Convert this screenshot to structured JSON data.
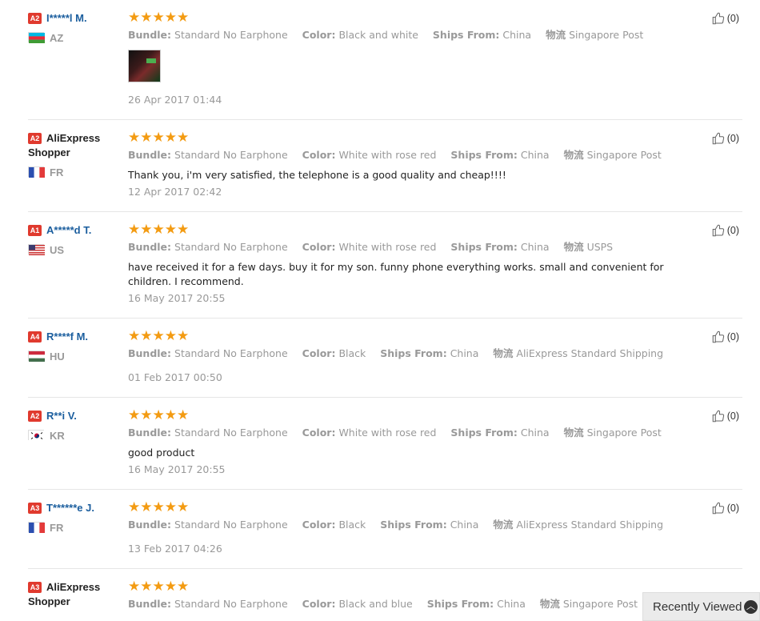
{
  "reviews": [
    {
      "level": "A2",
      "name": "I*****l M.",
      "shopper": false,
      "country": "AZ",
      "flag": "az",
      "stars": "★★★★★",
      "bundle_k": "Bundle:",
      "bundle_v": "Standard No Earphone",
      "color_k": "Color:",
      "color_v": "Black and white",
      "ships_k": "Ships From:",
      "ships_v": "China",
      "logistics_k": "物流",
      "logistics_v": "Singapore Post",
      "text": "",
      "has_photo": true,
      "date": "26 Apr 2017 01:44",
      "likes": "(0)"
    },
    {
      "level": "A2",
      "name": "AliExpress Shopper",
      "shopper": true,
      "country": "FR",
      "flag": "fr",
      "stars": "★★★★★",
      "bundle_k": "Bundle:",
      "bundle_v": "Standard No Earphone",
      "color_k": "Color:",
      "color_v": "White with rose red",
      "ships_k": "Ships From:",
      "ships_v": "China",
      "logistics_k": "物流",
      "logistics_v": "Singapore Post",
      "text": "Thank you, i'm very satisfied, the telephone is a good quality and cheap!!!!",
      "has_photo": false,
      "date": "12 Apr 2017 02:42",
      "likes": "(0)"
    },
    {
      "level": "A1",
      "name": "A*****d T.",
      "shopper": false,
      "country": "US",
      "flag": "us",
      "stars": "★★★★★",
      "bundle_k": "Bundle:",
      "bundle_v": "Standard No Earphone",
      "color_k": "Color:",
      "color_v": "White with rose red",
      "ships_k": "Ships From:",
      "ships_v": "China",
      "logistics_k": "物流",
      "logistics_v": "USPS",
      "text": "have received it for a few days. buy it for my son. funny phone everything works. small and convenient for children. I recommend.",
      "has_photo": false,
      "date": "16 May 2017 20:55",
      "likes": "(0)"
    },
    {
      "level": "A4",
      "name": "R****f M.",
      "shopper": false,
      "country": "HU",
      "flag": "hu",
      "stars": "★★★★★",
      "bundle_k": "Bundle:",
      "bundle_v": "Standard No Earphone",
      "color_k": "Color:",
      "color_v": "Black",
      "ships_k": "Ships From:",
      "ships_v": "China",
      "logistics_k": "物流",
      "logistics_v": "AliExpress Standard Shipping",
      "text": "",
      "has_photo": false,
      "date": "01 Feb 2017 00:50",
      "likes": "(0)"
    },
    {
      "level": "A2",
      "name": "R**i V.",
      "shopper": false,
      "country": "KR",
      "flag": "kr",
      "stars": "★★★★★",
      "bundle_k": "Bundle:",
      "bundle_v": "Standard No Earphone",
      "color_k": "Color:",
      "color_v": "White with rose red",
      "ships_k": "Ships From:",
      "ships_v": "China",
      "logistics_k": "物流",
      "logistics_v": "Singapore Post",
      "text": "good product",
      "has_photo": false,
      "date": "16 May 2017 20:55",
      "likes": "(0)"
    },
    {
      "level": "A3",
      "name": "T******e J.",
      "shopper": false,
      "country": "FR",
      "flag": "fr",
      "stars": "★★★★★",
      "bundle_k": "Bundle:",
      "bundle_v": "Standard No Earphone",
      "color_k": "Color:",
      "color_v": "Black",
      "ships_k": "Ships From:",
      "ships_v": "China",
      "logistics_k": "物流",
      "logistics_v": "AliExpress Standard Shipping",
      "text": "",
      "has_photo": false,
      "date": "13 Feb 2017 04:26",
      "likes": "(0)"
    },
    {
      "level": "A3",
      "name": "AliExpress Shopper",
      "shopper": true,
      "country": "",
      "flag": "",
      "stars": "★★★★★",
      "bundle_k": "Bundle:",
      "bundle_v": "Standard No Earphone",
      "color_k": "Color:",
      "color_v": "Black and blue",
      "ships_k": "Ships From:",
      "ships_v": "China",
      "logistics_k": "物流",
      "logistics_v": "Singapore Post",
      "text": "",
      "has_photo": false,
      "date": "",
      "likes": ""
    }
  ],
  "recently_viewed": "Recently Viewed",
  "colors": {
    "name_link": "#1b5e9e",
    "star": "#f39b12",
    "level_badge": "#e03a2e"
  }
}
